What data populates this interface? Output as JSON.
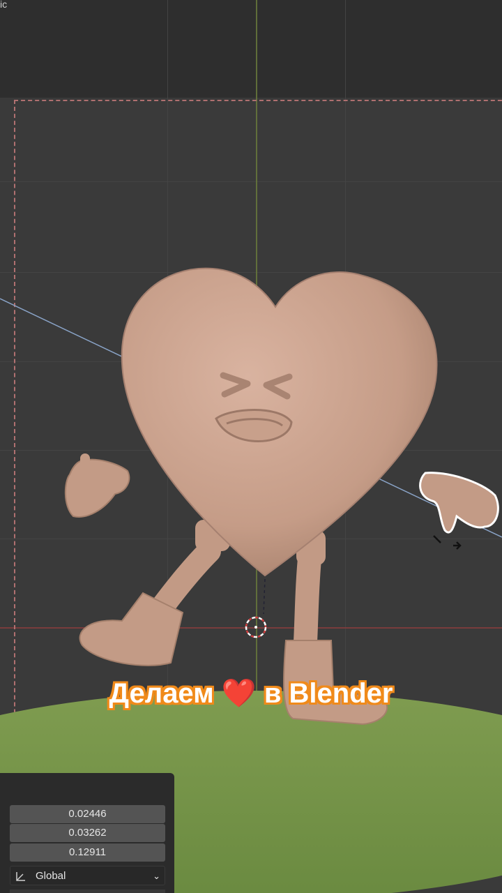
{
  "viewport": {
    "label": "ic"
  },
  "caption": {
    "text_before": "Делаем",
    "heart": "❤️",
    "text_after": "в Blender"
  },
  "operator_panel": {
    "values": [
      "0.02446",
      "0.03262",
      "0.12911"
    ],
    "orientation": "Global"
  },
  "colors": {
    "skin": "#c9a18c",
    "ground": "#7d9a4e",
    "caption_outline": "#f08a1a",
    "selection": "#ffffff"
  }
}
